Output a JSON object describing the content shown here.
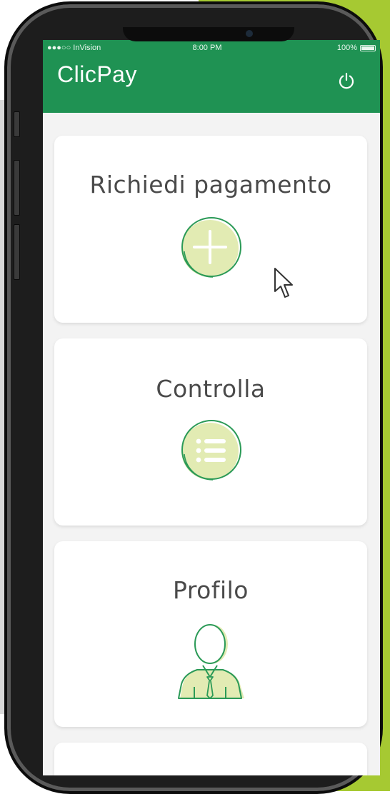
{
  "status_bar": {
    "carrier": "●●●○○ InVision",
    "time": "8:00 PM",
    "battery": "100%"
  },
  "header": {
    "title": "ClicPay",
    "power_icon": "power-icon"
  },
  "cards": [
    {
      "label": "Richiedi pagamento",
      "icon": "plus-circle-icon"
    },
    {
      "label": "Controlla",
      "icon": "list-circle-icon"
    },
    {
      "label": "Profilo",
      "icon": "user-profile-icon"
    }
  ],
  "colors": {
    "brand_green": "#1f9253",
    "accent_lime": "#a6c932",
    "icon_fill": "#e2ebb3",
    "icon_stroke": "#2b9a57"
  }
}
